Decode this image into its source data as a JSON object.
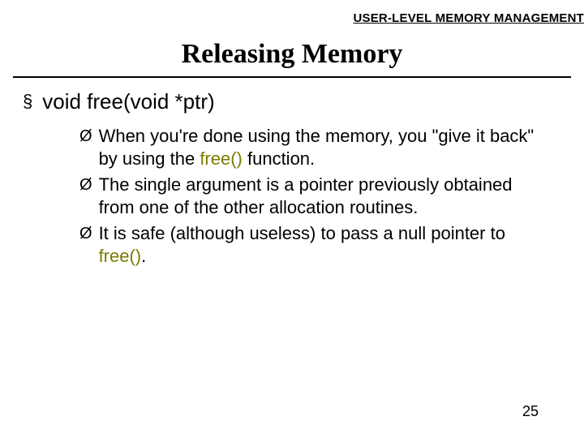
{
  "header": {
    "label": "USER-LEVEL MEMORY MANAGEMENT"
  },
  "title": "Releasing Memory",
  "bullets": {
    "lvl1": {
      "text": "void free(void *ptr)"
    },
    "lvl2": [
      {
        "pre": "When you're done using the memory, you \"give it back\" by using the ",
        "accent": "free()",
        "post": " function."
      },
      {
        "pre": "The single argument is a pointer previously obtained from one of the other allocation routines.",
        "accent": "",
        "post": ""
      },
      {
        "pre": " It is safe (although useless) to pass a null pointer to ",
        "accent": "free()",
        "post": "."
      }
    ]
  },
  "glyphs": {
    "square": "§",
    "arrow": "Ø"
  },
  "page": "25"
}
